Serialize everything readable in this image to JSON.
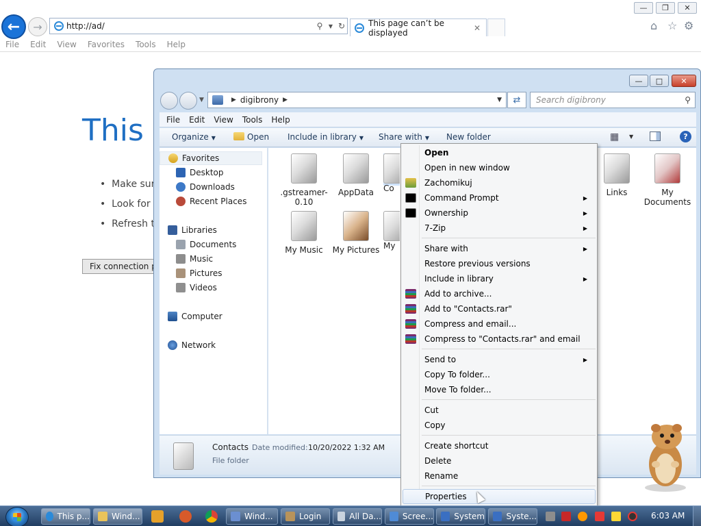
{
  "browser": {
    "address": "http://ad/",
    "tab_title": "This page can’t be displayed",
    "menu": [
      "File",
      "Edit",
      "View",
      "Favorites",
      "Tools",
      "Help"
    ],
    "content": {
      "heading_partial": "This p",
      "bullets": [
        "Make sure",
        "Look for t",
        "Refresh th"
      ],
      "fix_button": "Fix connection problems"
    }
  },
  "explorer": {
    "breadcrumb": "digibrony",
    "search_placeholder": "Search digibrony",
    "menu": [
      "File",
      "Edit",
      "View",
      "Tools",
      "Help"
    ],
    "toolbar": {
      "organize": "Organize",
      "open": "Open",
      "include_in_library": "Include in library",
      "share_with": "Share with",
      "new_folder": "New folder"
    },
    "nav": {
      "favorites": "Favorites",
      "desktop": "Desktop",
      "downloads": "Downloads",
      "recent_places": "Recent Places",
      "libraries": "Libraries",
      "documents": "Documents",
      "music": "Music",
      "pictures": "Pictures",
      "videos": "Videos",
      "computer": "Computer",
      "network": "Network"
    },
    "files": [
      {
        "label": ".gstreamer-\n0.10"
      },
      {
        "label": "AppData"
      },
      {
        "label": "Co"
      },
      {
        "label": "Links"
      },
      {
        "label": "My\nDocuments"
      },
      {
        "label": "My Music"
      },
      {
        "label": "My Pictures"
      },
      {
        "label": "My"
      }
    ],
    "details": {
      "name": "Contacts",
      "modified_label": "Date modified:",
      "modified_value": "10/20/2022 1:32 AM",
      "type": "File folder"
    }
  },
  "context_menu": {
    "items": [
      {
        "label": "Open",
        "bold": true
      },
      {
        "label": "Open in new window"
      },
      {
        "label": "Zachomikuj",
        "icon": "user-icon"
      },
      {
        "label": "Command Prompt",
        "icon": "cmd-icon",
        "submenu": true
      },
      {
        "label": "Ownership",
        "icon": "cmd-icon",
        "submenu": true
      },
      {
        "label": "7-Zip",
        "submenu": true
      },
      {
        "label": "Share with",
        "submenu": true
      },
      {
        "label": "Restore previous versions"
      },
      {
        "label": "Include in library",
        "submenu": true
      },
      {
        "label": "Add to archive...",
        "icon": "rar-icon"
      },
      {
        "label": "Add to \"Contacts.rar\"",
        "icon": "rar-icon"
      },
      {
        "label": "Compress and email...",
        "icon": "rar-icon"
      },
      {
        "label": "Compress to \"Contacts.rar\" and email",
        "icon": "rar-icon"
      },
      {
        "label": "Send to",
        "submenu": true
      },
      {
        "label": "Copy To folder..."
      },
      {
        "label": "Move To folder..."
      },
      {
        "label": "Cut"
      },
      {
        "label": "Copy"
      },
      {
        "label": "Create shortcut"
      },
      {
        "label": "Delete"
      },
      {
        "label": "Rename"
      },
      {
        "label": "Properties",
        "highlighted": true
      }
    ]
  },
  "taskbar": {
    "buttons": [
      "This p...",
      "Wind...",
      "Wind...",
      "Login",
      "All Da...",
      "Scree...",
      "System",
      "Syste..."
    ],
    "clock": "6:03 AM"
  }
}
